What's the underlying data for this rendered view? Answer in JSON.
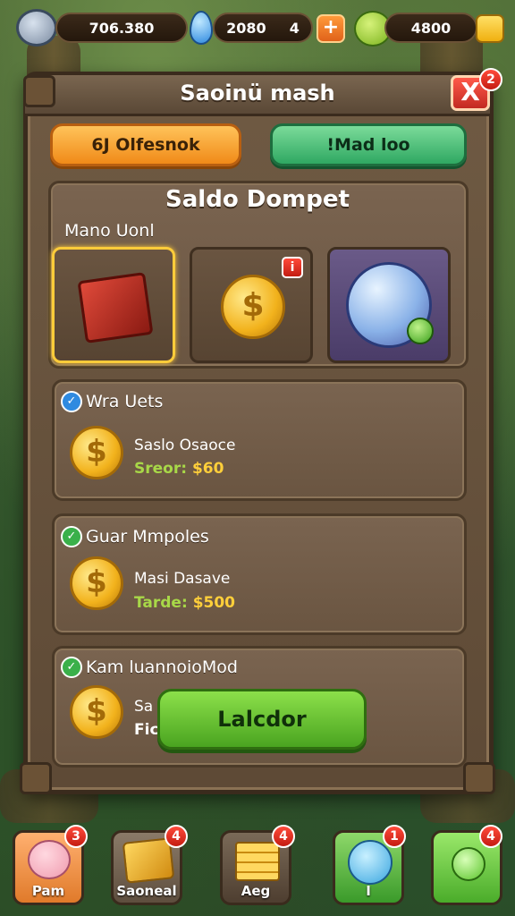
{
  "hud": {
    "stone_value": "706.380",
    "gem_value": "2080",
    "gem_extra": "4",
    "gem_plus": "+",
    "leaf_value": "4800"
  },
  "panel": {
    "title": "Saoinü mash",
    "close_label": "X",
    "close_badge": "2",
    "tab_left": "6J Olfesnok",
    "tab_right": "!Mad loo",
    "section_title": "Saldo Dompet",
    "sub_title": "Mano Uonl"
  },
  "items": [
    {
      "name": "red-box",
      "badge": ""
    },
    {
      "name": "gold-coin",
      "badge": "i"
    },
    {
      "name": "crystal-orb",
      "badge": ""
    }
  ],
  "rows": [
    {
      "title": "Wra Uets",
      "label": "Saslo Osaoce",
      "key": "Sreor:",
      "value": "$60"
    },
    {
      "title": "Guar Mmpoles",
      "label": "Masi Dasave",
      "key": "Tarde:",
      "value": "$500"
    },
    {
      "title": "Kam luannoioMod",
      "label": "Sa",
      "key": "Fic",
      "value": ""
    }
  ],
  "action_label": "Lalcdor",
  "bottom": [
    {
      "label": "Pam",
      "badge": "3",
      "color": "#e88a4a"
    },
    {
      "label": "Saoneal",
      "badge": "4",
      "color": "#7a6a58"
    },
    {
      "label": "Aeg",
      "badge": "4",
      "color": "#6a5a4a"
    },
    {
      "label": "I",
      "badge": "1",
      "color": "#5ab84a"
    },
    {
      "label": "",
      "badge": "4",
      "color": "#6ac44a"
    }
  ]
}
